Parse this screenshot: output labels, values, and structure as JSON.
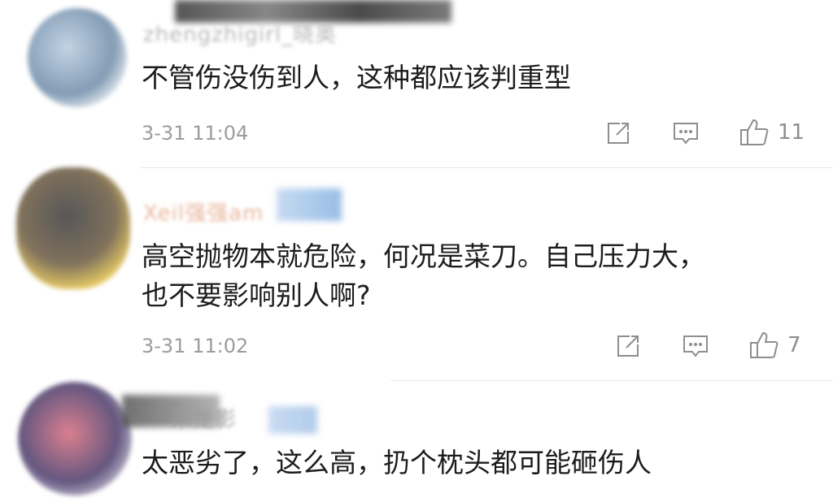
{
  "comments": [
    {
      "username": "zhengzhigirl_晓奥",
      "text_lines": [
        "不管伤没伤到人，这种都应该判重型"
      ],
      "time": "3-31 11:04",
      "likes": "11"
    },
    {
      "username": "Xeil强强am",
      "text_lines": [
        "高空抛物本就危险，何况是菜刀。自己压力大，",
        "也不要影响别人啊?"
      ],
      "time": "3-31 11:02",
      "likes": "7"
    },
    {
      "username": "朱龙影",
      "text_lines": [
        "太恶劣了，这么高，扔个枕头都可能砸伤人"
      ],
      "time": "",
      "likes": ""
    }
  ],
  "icons": {
    "share": "share-icon",
    "reply": "comment-icon",
    "like": "thumbs-up-icon"
  },
  "colors": {
    "text": "#1c1c1c",
    "meta": "#9c9c9c",
    "icon": "#8e8e8e",
    "divider": "#e8e8e8"
  }
}
